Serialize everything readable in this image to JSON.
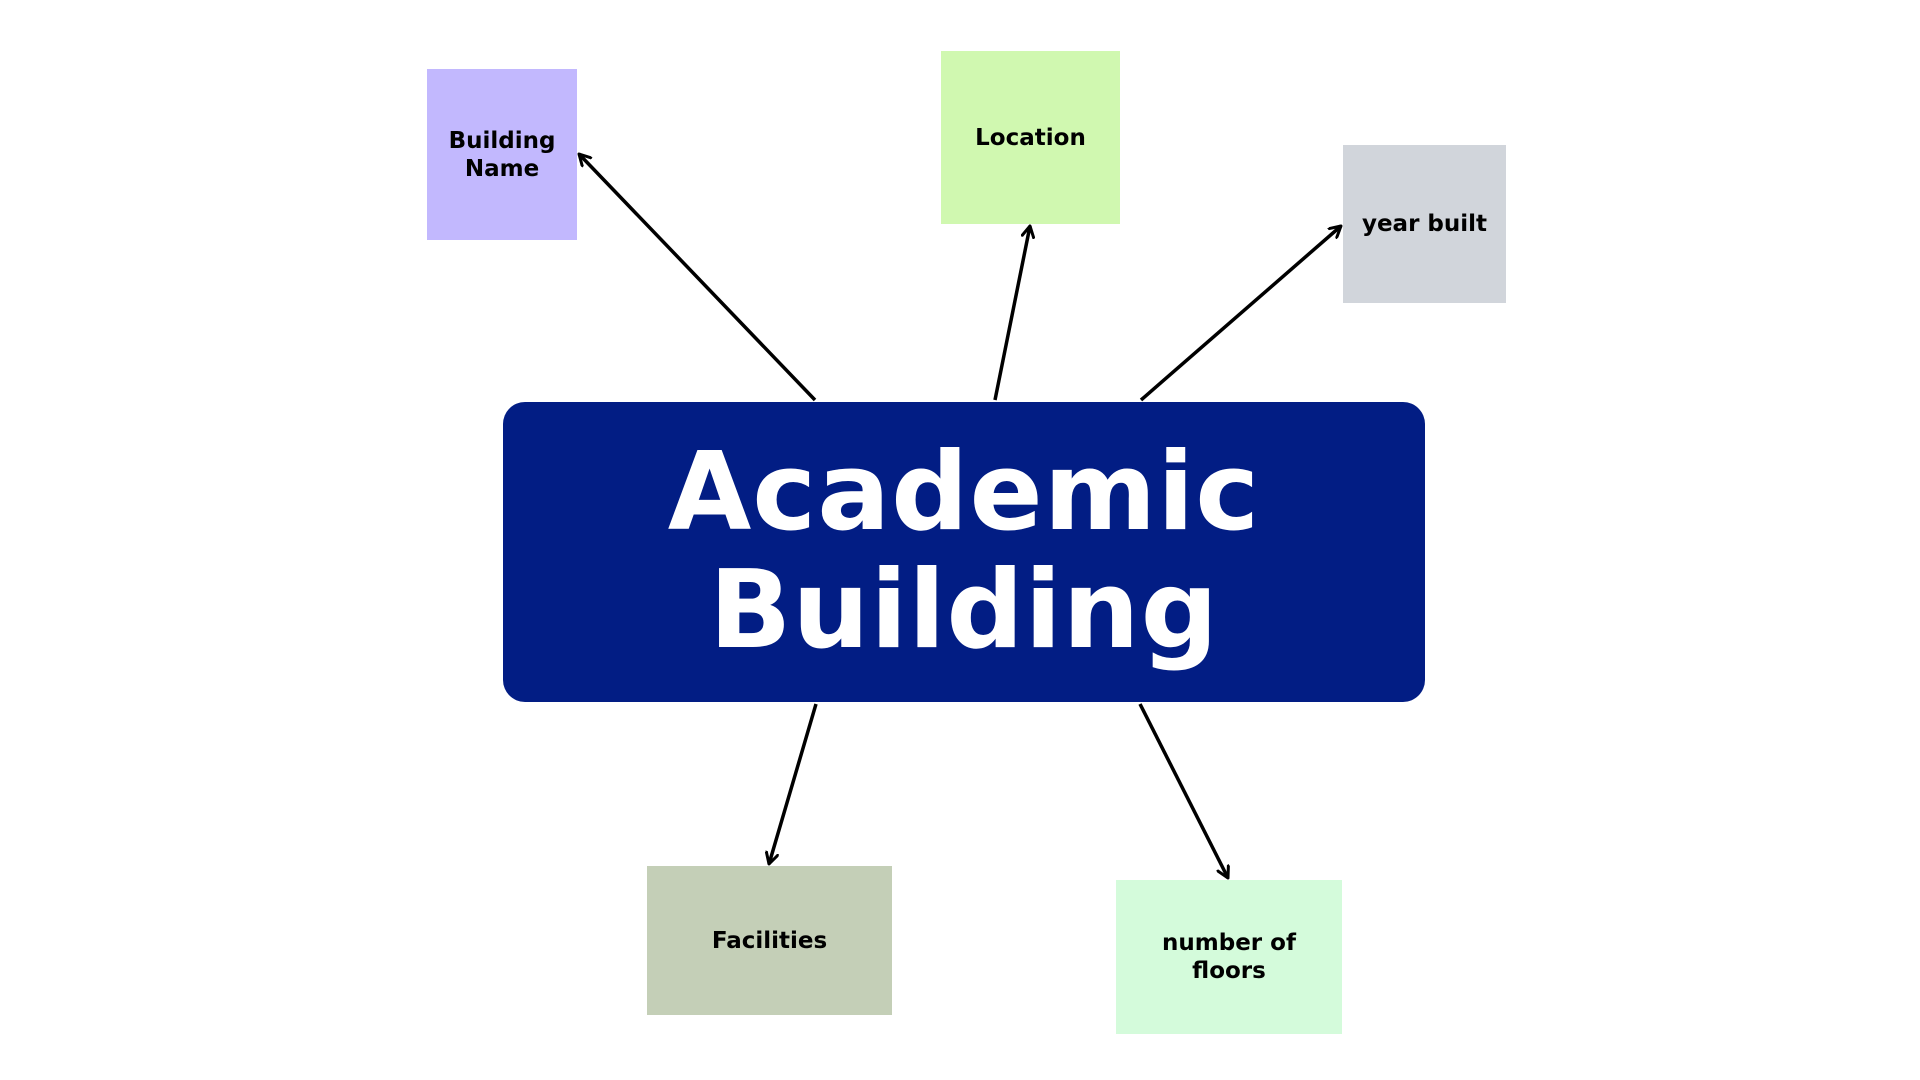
{
  "central": {
    "line1": "Academic",
    "line2": "Building",
    "color": "#021d84"
  },
  "nodes": [
    {
      "id": "building-name",
      "label": "Building Name",
      "color": "#c2b8fe"
    },
    {
      "id": "location",
      "label": "Location",
      "color": "#d0f8b0"
    },
    {
      "id": "year-built",
      "label": "year built",
      "color": "#d1d5db"
    },
    {
      "id": "facilities",
      "label": "Facilities",
      "color": "#c4cfb7"
    },
    {
      "id": "floors",
      "label": "number of floors",
      "color": "#d4fbdb"
    }
  ],
  "arrow_color": "#000000"
}
